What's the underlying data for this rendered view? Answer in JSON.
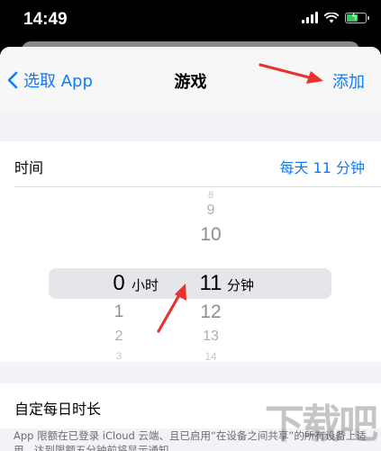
{
  "status_bar": {
    "time": "14:49"
  },
  "nav": {
    "back_label": "选取 App",
    "title": "游戏",
    "add_label": "添加"
  },
  "time_row": {
    "label": "时间",
    "value": "每天 11 分钟"
  },
  "picker": {
    "hours": {
      "above": [],
      "selected": "0",
      "below": [
        "1",
        "2",
        "3"
      ],
      "unit": "小时"
    },
    "minutes": {
      "above": [
        "8",
        "9",
        "10"
      ],
      "selected": "11",
      "below": [
        "12",
        "13",
        "14"
      ],
      "unit": "分钟"
    }
  },
  "custom_row": {
    "label": "自定每日时长"
  },
  "footer_note": "App 限额在已登录 iCloud 云端、且已启用“在设备之间共享”的所有设备上适用。达到限额五分钟前将显示通知。",
  "watermark": "下载吧",
  "colors": {
    "accent": "#0a7cff",
    "arrow": "#e8322e",
    "battery": "#34c759"
  },
  "icons": [
    "signal-bars-icon",
    "wifi-icon",
    "battery-charging-icon",
    "chevron-left-icon",
    "red-arrow-annotation"
  ]
}
